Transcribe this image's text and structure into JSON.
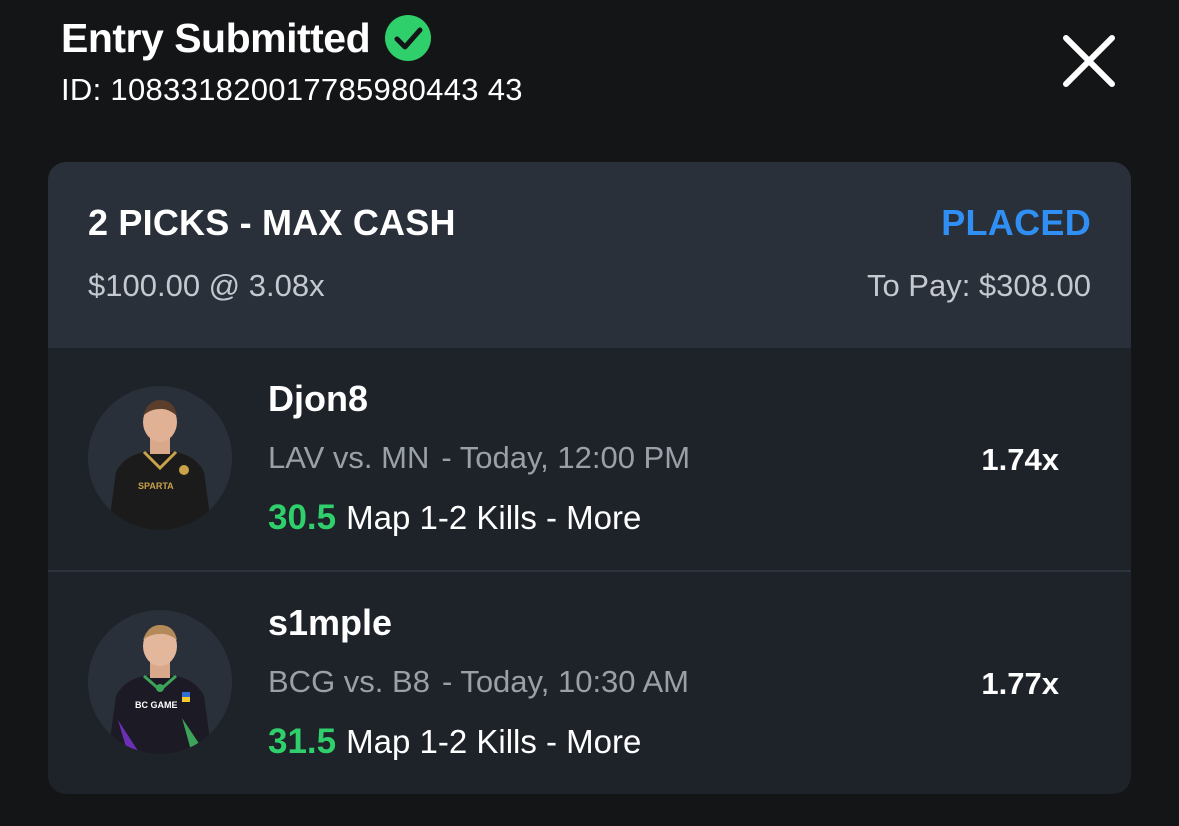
{
  "header": {
    "title": "Entry Submitted",
    "id_text": "ID: 108331820017785980443 43",
    "check_icon": "check-circle-icon",
    "close_icon": "close-icon"
  },
  "entry": {
    "type": "2 PICKS - MAX CASH",
    "status": "PLACED",
    "stake": "$100.00 @ 3.08x",
    "to_pay": "To Pay: $308.00"
  },
  "picks": [
    {
      "player": "Djon8",
      "match": "LAV vs. MN",
      "time": "- Today, 12:00 PM",
      "line_value": "30.5",
      "line_desc": "Map 1-2 Kills - More",
      "multiplier": "1.74x"
    },
    {
      "player": "s1mple",
      "match": "BCG vs. B8",
      "time": "- Today, 10:30 AM",
      "line_value": "31.5",
      "line_desc": "Map 1-2 Kills - More",
      "multiplier": "1.77x"
    }
  ],
  "colors": {
    "background": "#141517",
    "card": "#1e2329",
    "card_header": "#2a3039",
    "status_blue": "#2f8ff5",
    "line_green": "#2fcf6b",
    "check_green": "#2fcf6b"
  }
}
